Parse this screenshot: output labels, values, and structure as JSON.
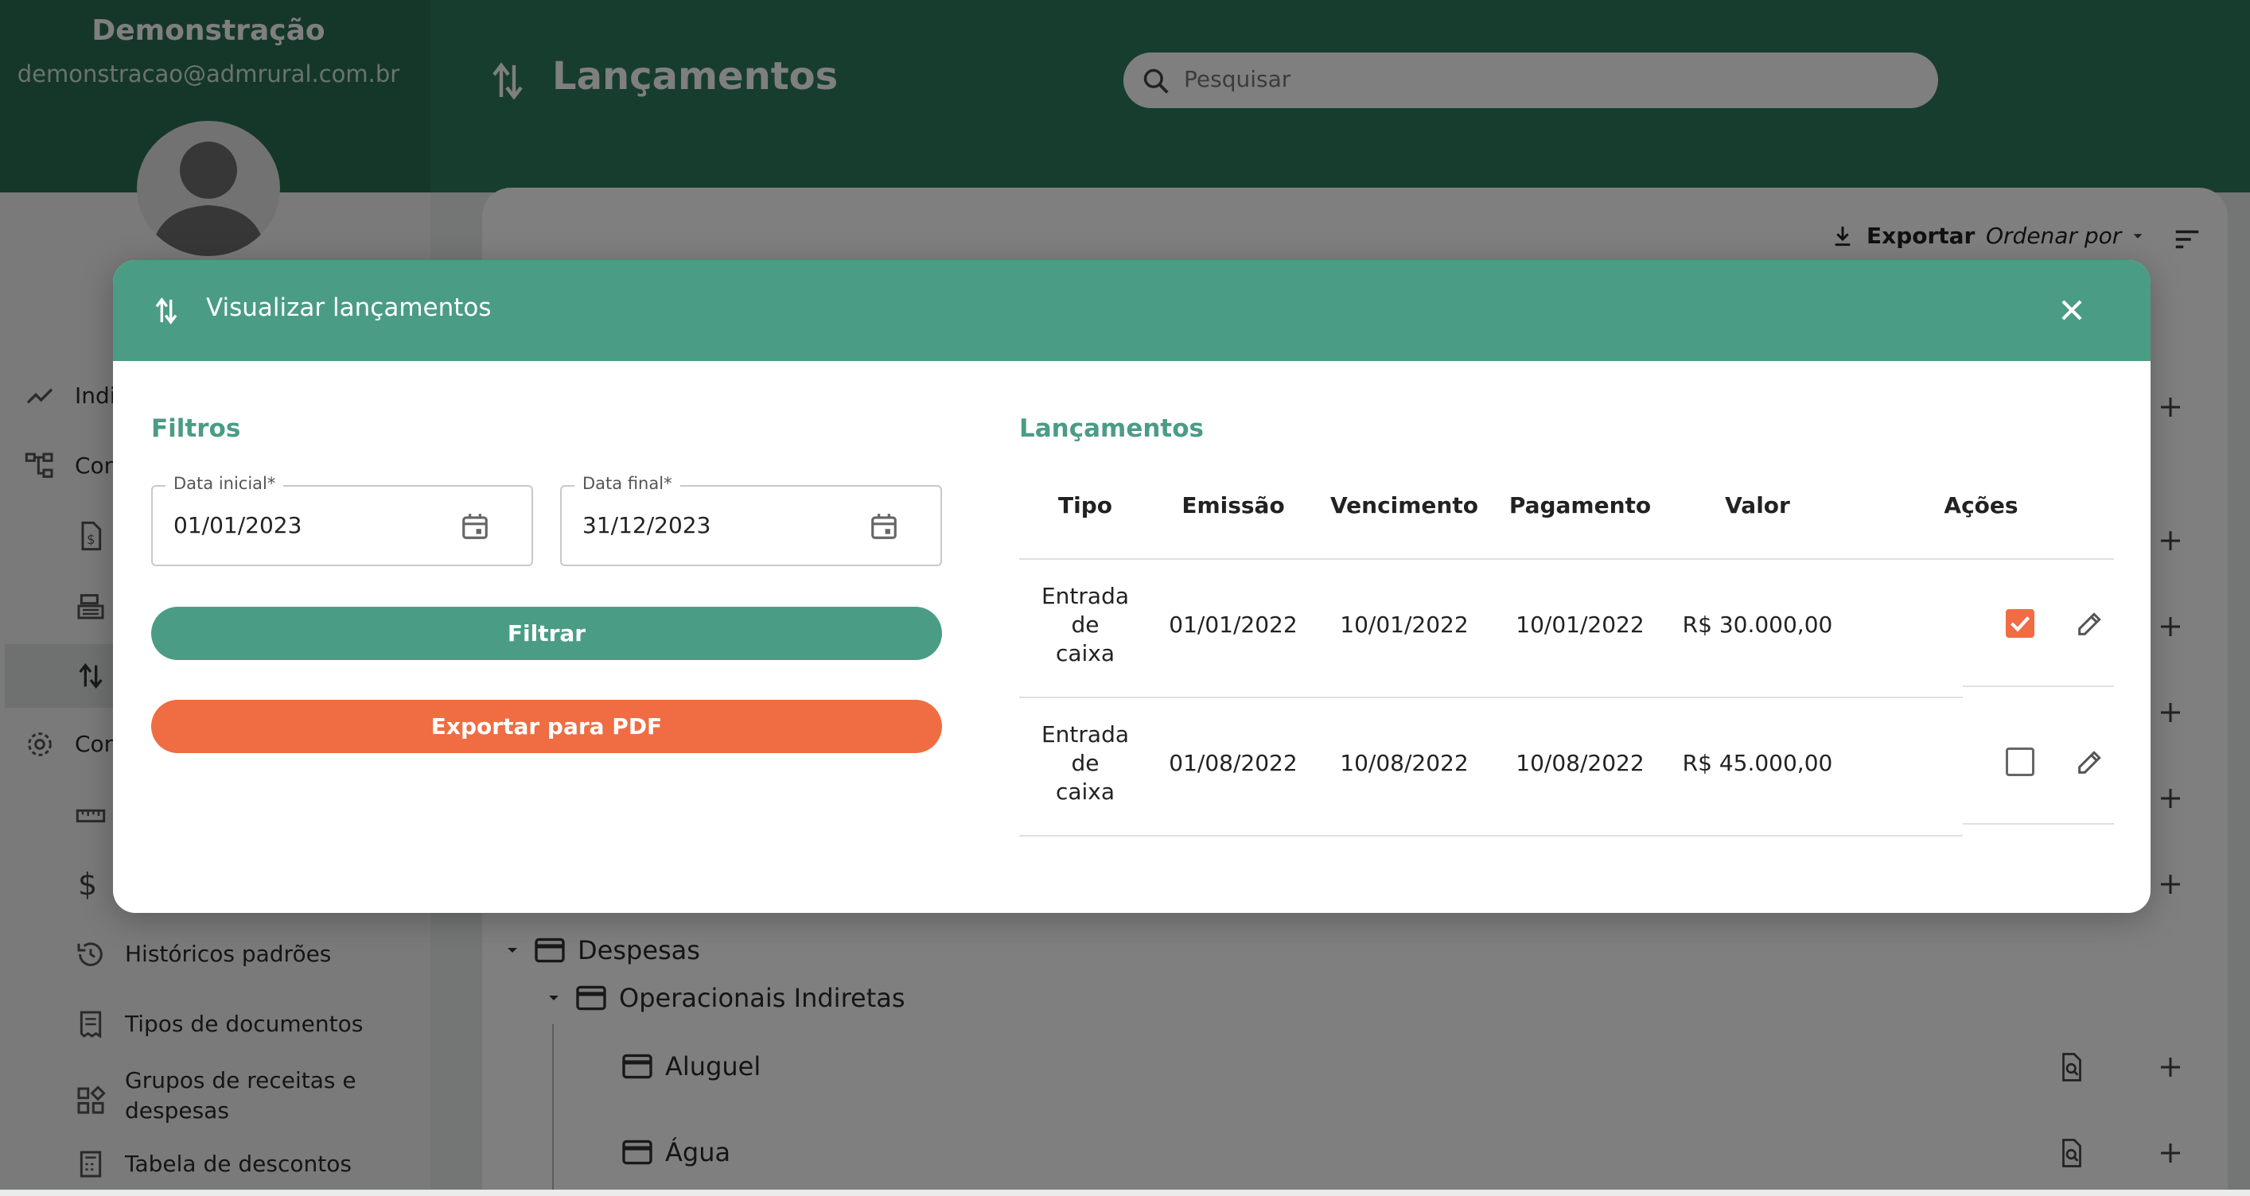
{
  "sidebar": {
    "user_name": "Demonstração",
    "user_email": "demonstracao@admrural.com.br",
    "items": [
      {
        "label": "Indi",
        "icon": "trending-up-icon"
      },
      {
        "label": "Con",
        "icon": "account-tree-icon"
      },
      {
        "label": "",
        "icon": "invoice-icon"
      },
      {
        "label": "",
        "icon": "cash-register-icon"
      },
      {
        "label": "",
        "icon": "swap-vert-icon"
      },
      {
        "label": "Con",
        "icon": "gear-icon"
      },
      {
        "label": "",
        "icon": "ruler-icon"
      },
      {
        "label": "",
        "icon": "dollar-icon"
      },
      {
        "label": "Históricos padrões",
        "icon": "history-icon"
      },
      {
        "label": "Tipos de documentos",
        "icon": "receipt-icon"
      },
      {
        "label": "Grupos de receitas e despesas",
        "icon": "widgets-icon"
      },
      {
        "label": "Tabela de descontos",
        "icon": "calculator-icon"
      }
    ]
  },
  "header": {
    "title": "Lançamentos",
    "search_placeholder": "Pesquisar"
  },
  "toolbar": {
    "export_label": "Exportar",
    "order_by_label": "Ordenar por"
  },
  "tree": {
    "group": "Despesas",
    "subgroup": "Operacionais Indiretas",
    "items": [
      "Aluguel",
      "Água"
    ]
  },
  "modal": {
    "title": "Visualizar lançamentos",
    "filters": {
      "title": "Filtros",
      "start_label": "Data inicial",
      "start_value": "01/01/2023",
      "end_label": "Data final",
      "end_value": "31/12/2023",
      "required_mark": "*",
      "filter_button": "Filtrar",
      "export_pdf_button": "Exportar para PDF"
    },
    "entries": {
      "title": "Lançamentos",
      "columns": [
        "Tipo",
        "Emissão",
        "Vencimento",
        "Pagamento",
        "Valor",
        "Ações"
      ],
      "rows": [
        {
          "tipo": [
            "Entrada",
            "de",
            "caixa"
          ],
          "emissao": "01/01/2022",
          "vencimento": "10/01/2022",
          "pagamento": "10/01/2022",
          "valor": "R$ 30.000,00",
          "checked": true
        },
        {
          "tipo": [
            "Entrada",
            "de",
            "caixa"
          ],
          "emissao": "01/08/2022",
          "vencimento": "10/08/2022",
          "pagamento": "10/08/2022",
          "valor": "R$ 45.000,00",
          "checked": false
        }
      ]
    },
    "colors": {
      "primary": "#4b9c85",
      "accent": "#f06c43",
      "header_dark": "#2f7a5e"
    }
  }
}
